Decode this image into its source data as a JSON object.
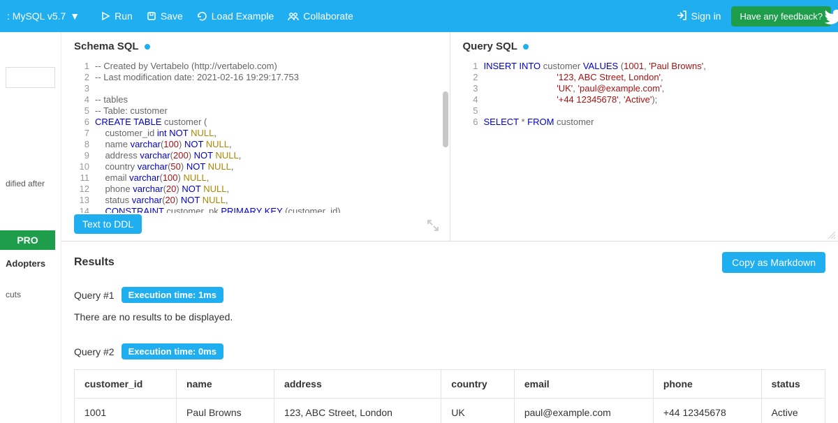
{
  "topbar": {
    "db_label": ": MySQL v5.7",
    "run": "Run",
    "save": "Save",
    "load": "Load Example",
    "collab": "Collaborate",
    "signin": "Sign in",
    "feedback": "Have any feedback?"
  },
  "sidebar": {
    "modified": "dified after",
    "pro": "PRO",
    "adopters": "Adopters",
    "cuts": "cuts"
  },
  "schema": {
    "title": "Schema SQL",
    "lines": 14,
    "text_to_ddl": "Text to DDL",
    "code": [
      {
        "t": "-- Created by Vertabelo (http://vertabelo.com)"
      },
      {
        "t": "-- Last modification date: 2021-02-16 19:29:17.753"
      },
      {
        "t": ""
      },
      {
        "t": "-- tables"
      },
      {
        "t": "-- Table: customer"
      },
      {
        "t": "CREATE TABLE customer (",
        "kw": [
          "CREATE",
          "TABLE"
        ]
      },
      {
        "t": "    customer_id int NOT NULL,",
        "kw": [
          "int",
          "NOT"
        ],
        "nl": [
          "NULL"
        ]
      },
      {
        "t": "    name varchar(100) NOT NULL,",
        "kw": [
          "varchar",
          "NOT"
        ],
        "num": [
          "100"
        ],
        "nl": [
          "NULL"
        ]
      },
      {
        "t": "    address varchar(200) NOT NULL,",
        "kw": [
          "varchar",
          "NOT"
        ],
        "num": [
          "200"
        ],
        "nl": [
          "NULL"
        ]
      },
      {
        "t": "    country varchar(50) NOT NULL,",
        "kw": [
          "varchar",
          "NOT"
        ],
        "num": [
          "50"
        ],
        "nl": [
          "NULL"
        ]
      },
      {
        "t": "    email varchar(100) NULL,",
        "kw": [
          "varchar"
        ],
        "num": [
          "100"
        ],
        "nl": [
          "NULL"
        ]
      },
      {
        "t": "    phone varchar(20) NOT NULL,",
        "kw": [
          "varchar",
          "NOT"
        ],
        "num": [
          "20"
        ],
        "nl": [
          "NULL"
        ]
      },
      {
        "t": "    status varchar(20) NOT NULL,",
        "kw": [
          "varchar",
          "NOT"
        ],
        "num": [
          "20"
        ],
        "nl": [
          "NULL"
        ]
      },
      {
        "t": "    CONSTRAINT customer_pk PRIMARY KEY (customer_id)",
        "kw": [
          "CONSTRAINT",
          "PRIMARY",
          "KEY"
        ]
      }
    ]
  },
  "query": {
    "title": "Query SQL",
    "lines": 6,
    "code": [
      {
        "raw": "<span class='kw'>INSERT</span> <span class='kw'>INTO</span> customer <span class='kw'>VALUES</span> (<span class='num'>1001</span>, <span class='str'>'Paul Browns'</span>,"
      },
      {
        "raw": "                             <span class='str'>'123, ABC Street, London'</span>,"
      },
      {
        "raw": "                             <span class='str'>'UK'</span>, <span class='str'>'paul@example.com'</span>,"
      },
      {
        "raw": "                             <span class='str'>'+44 12345678'</span>, <span class='str'>'Active'</span>);"
      },
      {
        "raw": ""
      },
      {
        "raw": "<span class='kw'>SELECT</span> * <span class='kw'>FROM</span> customer"
      }
    ]
  },
  "results": {
    "title": "Results",
    "copy": "Copy as Markdown",
    "q1": {
      "label": "Query #1",
      "badge": "Execution time: 1ms",
      "msg": "There are no results to be displayed."
    },
    "q2": {
      "label": "Query #2",
      "badge": "Execution time: 0ms"
    },
    "columns": [
      "customer_id",
      "name",
      "address",
      "country",
      "email",
      "phone",
      "status"
    ],
    "rows": [
      [
        "1001",
        "Paul Browns",
        "123, ABC Street, London",
        "UK",
        "paul@example.com",
        "+44 12345678",
        "Active"
      ]
    ]
  }
}
